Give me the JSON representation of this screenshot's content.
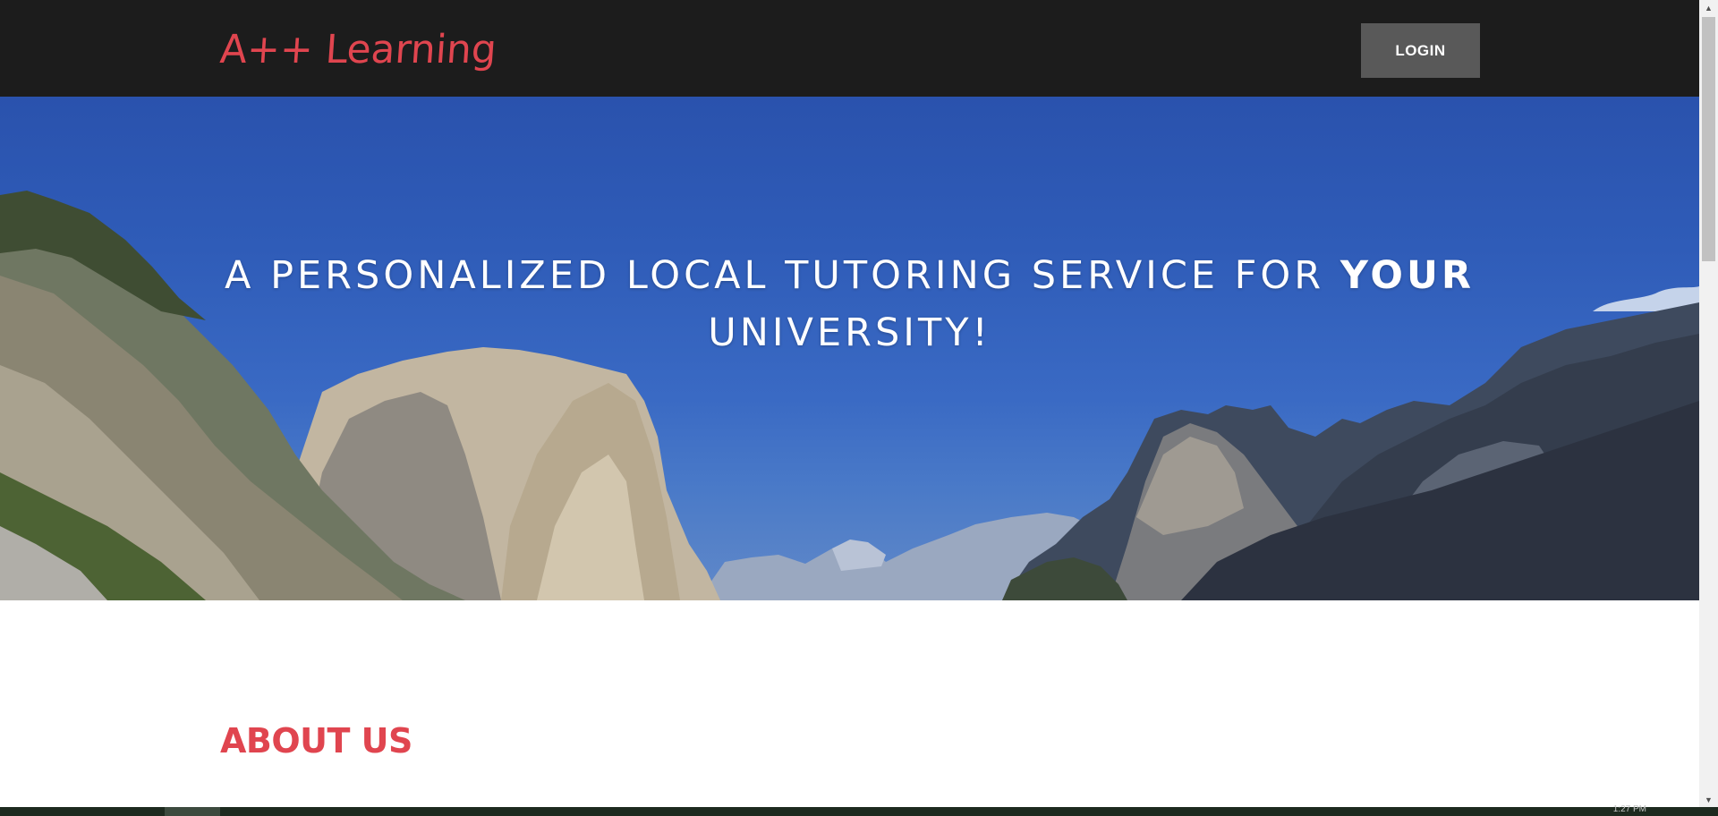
{
  "brand": {
    "name": "A++ Learning",
    "color": "#e0454f"
  },
  "nav": {
    "login_label": "LOGIN"
  },
  "hero": {
    "headline_prefix": "A PERSONALIZED LOCAL TUTORING SERVICE FOR ",
    "headline_emphasis": "YOUR",
    "headline_suffix": "UNIVERSITY!"
  },
  "about": {
    "title": "ABOUT US"
  },
  "taskbar": {
    "clock": "1:27 PM"
  },
  "colors": {
    "navbar_bg": "#1c1c1c",
    "login_bg": "#595959",
    "accent": "#e0454f",
    "sky": "#2f5cb8"
  },
  "icons": {
    "scroll_up": "triangle-up-icon",
    "scroll_down": "triangle-down-icon"
  }
}
